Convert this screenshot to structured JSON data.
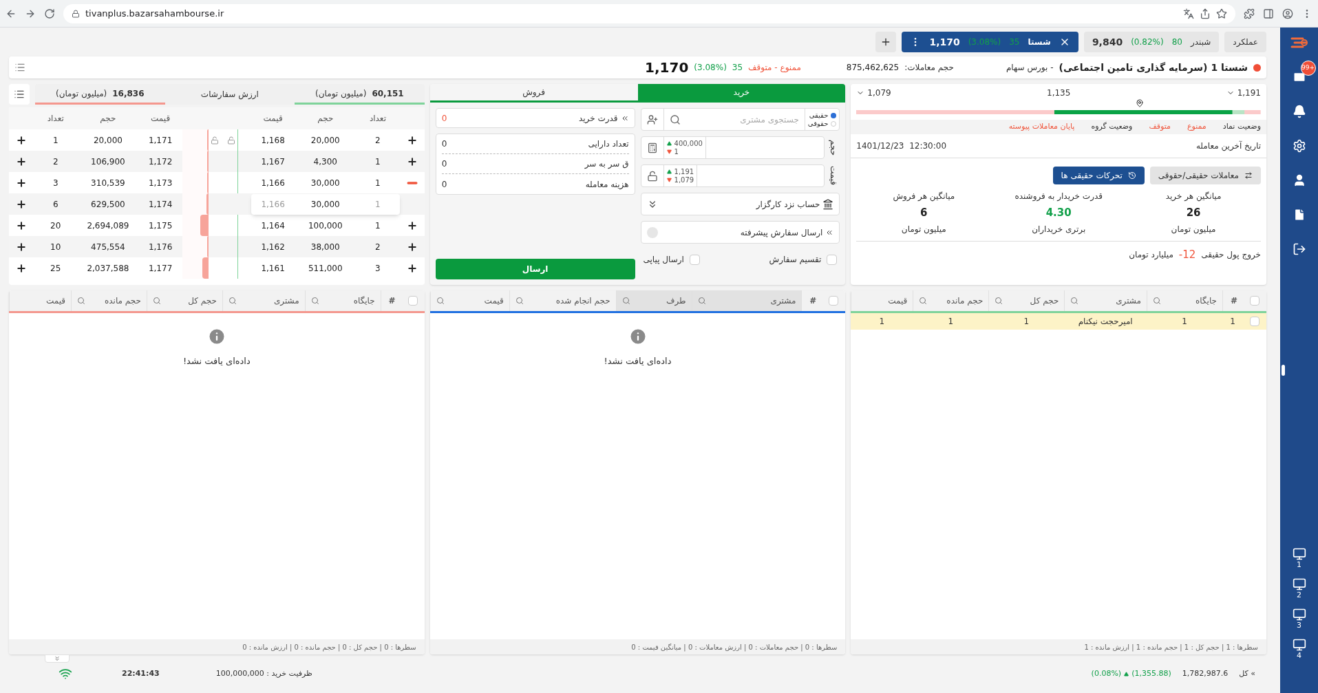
{
  "browser": {
    "url": "tivanplus.bazarsahambourse.ir"
  },
  "tabs": [
    {
      "kind": "plain",
      "label": "عملکرد"
    },
    {
      "kind": "symbol",
      "name": "شبندر",
      "change": "80",
      "percent": "(0.82%)",
      "price": "9,840",
      "selected": false
    },
    {
      "kind": "symbol",
      "name": "شستا",
      "change": "35",
      "percent": "(3.08%)",
      "price": "1,170",
      "selected": true
    }
  ],
  "symbol_header": {
    "name": "شستا 1 (سرمایه گذاری تامین اجتماعی)",
    "market": "- بورس سهام",
    "volume_label": "حجم معاملات:",
    "volume": "875,462,625",
    "state": "ممنوع - متوقف",
    "change": "35",
    "percent": "(3.08%)",
    "price": "1,170"
  },
  "order_book": {
    "buy_value": "60,151",
    "buy_unit": "(میلیون تومان)",
    "value_label": "ارزش سفارشات",
    "sell_value": "16,836",
    "sell_unit": "(میلیون تومان)",
    "buy_columns": [
      "تعداد",
      "حجم",
      "قیمت"
    ],
    "sell_columns": [
      "قیمت",
      "حجم",
      "تعداد"
    ],
    "rows": [
      {
        "buy": {
          "count": "2",
          "volume": "20,000",
          "price": "1,168"
        },
        "sell": {
          "price": "1,171",
          "volume": "20,000",
          "count": "1",
          "level": 0.05
        },
        "locks": true,
        "hovered": false,
        "popup": false
      },
      {
        "buy": {
          "count": "1",
          "volume": "4,300",
          "price": "1,167"
        },
        "sell": {
          "price": "1,172",
          "volume": "106,900",
          "count": "2",
          "level": 0.06
        },
        "locks": false,
        "hovered": false,
        "popup": false
      },
      {
        "buy": {
          "count": "1",
          "volume": "30,000",
          "price": "1,166"
        },
        "sell": {
          "price": "1,173",
          "volume": "310,539",
          "count": "3",
          "level": 0.05
        },
        "locks": false,
        "hovered": true,
        "popup": false
      },
      {
        "buy": {
          "count": "1",
          "volume": "30,000",
          "price": "1,166"
        },
        "sell": {
          "price": "1,174",
          "volume": "629,500",
          "count": "6",
          "level": 0.08
        },
        "locks": false,
        "hovered": false,
        "popup": true
      },
      {
        "buy": {
          "count": "1",
          "volume": "100,000",
          "price": "1,164"
        },
        "sell": {
          "price": "1,175",
          "volume": "2,694,089",
          "count": "20",
          "level": 0.3
        },
        "locks": false,
        "hovered": false,
        "popup": false
      },
      {
        "buy": {
          "count": "2",
          "volume": "38,000",
          "price": "1,162"
        },
        "sell": {
          "price": "1,176",
          "volume": "475,554",
          "count": "10",
          "level": 0.05
        },
        "locks": false,
        "hovered": false,
        "popup": false
      },
      {
        "buy": {
          "count": "3",
          "volume": "511,000",
          "price": "1,161"
        },
        "sell": {
          "price": "1,177",
          "volume": "2,037,588",
          "count": "25",
          "level": 0.22
        },
        "locks": false,
        "hovered": false,
        "popup": false
      }
    ]
  },
  "order_form": {
    "tabs": [
      {
        "label": "خرید",
        "selected": true
      },
      {
        "label": "فروش",
        "selected": false
      }
    ],
    "customer_types": [
      {
        "label": "حقیقی",
        "selected": true
      },
      {
        "label": "حقوقی",
        "selected": false
      }
    ],
    "search": {
      "placeholder": "جستجوی مشتری"
    },
    "volume": {
      "label": "حجم",
      "max": "400,000",
      "min": "1"
    },
    "price": {
      "label": "قیمت",
      "max": "1,191",
      "min": "1,079"
    },
    "account": "حساب نزد کارگزار",
    "advanced": "ارسال سفارش پیشرفته",
    "options": [
      {
        "label": "تقسیم سفارش",
        "checked": false
      },
      {
        "label": "ارسال پیاپی",
        "checked": false
      }
    ],
    "buying_power": {
      "label": "قدرت خرید",
      "value": "0"
    },
    "info": [
      {
        "label": "تعداد دارایی",
        "value": "0"
      },
      {
        "label": "ق سر به سر",
        "value": "0"
      },
      {
        "label": "هزینه معامله",
        "value": "0"
      }
    ],
    "submit": "ارسال"
  },
  "symbol_info": {
    "range": {
      "high": "1,191",
      "mid": "1,135",
      "low": "1,079",
      "level": 0.7
    },
    "status": [
      {
        "text": "وضعیت نماد",
        "kind": "label"
      },
      {
        "text": "ممنوع",
        "kind": "alert"
      },
      {
        "text": "متوقف",
        "kind": "alert"
      },
      {
        "text": "وضعیت گروه",
        "kind": "label"
      },
      {
        "text": "پایان معاملات پیوسته",
        "kind": "alert"
      }
    ],
    "last_trade_label": "تاریخ آخرین معامله",
    "last_trade": "1401/12/23  12:30:00",
    "buttons": [
      {
        "label": "معاملات حقیقی/حقوقی",
        "kind": "secondary"
      },
      {
        "label": "تحرکات حقیقی ها",
        "kind": "primary"
      }
    ],
    "stats": [
      {
        "label": "میانگین هر خرید",
        "value": "26",
        "unit": "میلیون تومان",
        "kind": "plain"
      },
      {
        "label": "قدرت خریدار به فروشنده",
        "value": "4.30",
        "unit": "برتری خریداران",
        "kind": "positive"
      },
      {
        "label": "میانگین هر فروش",
        "value": "6",
        "unit": "میلیون تومان",
        "kind": "plain"
      }
    ],
    "outflow": {
      "label": "خروج پول حقیقی",
      "value": "-12",
      "unit": "میلیارد تومان"
    }
  },
  "tables": [
    {
      "color": "#7fd39a",
      "select_all": {
        "checked": false
      },
      "columns": [
        {
          "label": "#",
          "searchable": false
        },
        {
          "label": "جایگاه",
          "searchable": true
        },
        {
          "label": "مشتری",
          "searchable": true
        },
        {
          "label": "حجم کل",
          "searchable": true
        },
        {
          "label": "حجم مانده",
          "searchable": true
        },
        {
          "label": "قیمت",
          "searchable": false
        }
      ],
      "rows": [
        {
          "cells": [
            "1",
            "1",
            "امیرحجت نیکنام",
            "1",
            "1",
            "1"
          ],
          "selected": true,
          "checked": false
        }
      ],
      "footer": "سطرها : 1 | حجم کل : 1 | حجم مانده : 1 | ارزش مانده : 1"
    },
    {
      "color": "#1f6fe0",
      "select_all": {
        "checked": false
      },
      "columns": [
        {
          "label": "#",
          "searchable": false,
          "sorted": false
        },
        {
          "label": "مشتری",
          "searchable": true,
          "sorted": true
        },
        {
          "label": "طرف",
          "searchable": true,
          "sorted": true
        },
        {
          "label": "حجم انجام شده",
          "searchable": true,
          "sorted": false
        },
        {
          "label": "قیمت",
          "searchable": true,
          "sorted": false
        }
      ],
      "empty": "داده‌ای یافت نشد!",
      "footer": "سطرها : 0 | حجم معاملات : 0 | ارزش معاملات : 0 | میانگین قیمت : 0"
    },
    {
      "color": "#f4978e",
      "select_all": {
        "checked": false
      },
      "columns": [
        {
          "label": "#",
          "searchable": false
        },
        {
          "label": "جایگاه",
          "searchable": true
        },
        {
          "label": "مشتری",
          "searchable": true
        },
        {
          "label": "حجم کل",
          "searchable": true
        },
        {
          "label": "حجم مانده",
          "searchable": true
        },
        {
          "label": "قیمت",
          "searchable": false
        }
      ],
      "empty": "داده‌ای یافت نشد!",
      "footer": "سطرها : 0 | حجم کل : 0 | حجم مانده : 0 | ارزش مانده : 0"
    }
  ],
  "status_bar": {
    "index_label": "» کل",
    "index_value": "1,782,987.6",
    "index_change": "(1,355.88)",
    "index_percent": "(0.08%)",
    "capacity": "ظرفیت خرید : 100,000,000",
    "time": "22:41:43"
  },
  "sidebar": {
    "badge": "99+",
    "monitors": [
      "1",
      "2",
      "3",
      "4"
    ]
  }
}
